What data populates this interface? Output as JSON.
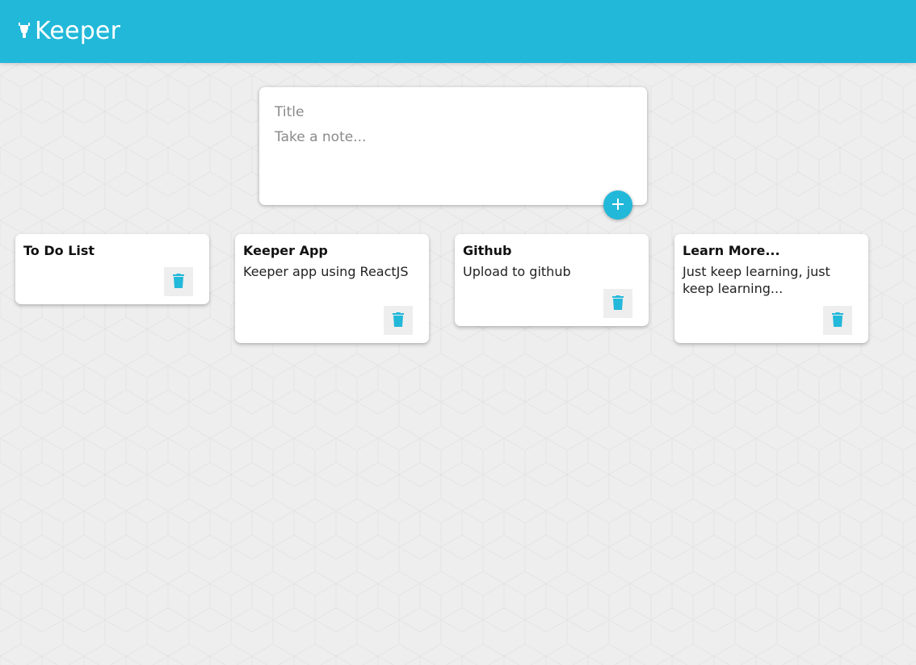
{
  "app": {
    "title": "Keeper",
    "accent_color": "#22b8d9",
    "logo_icon": "lightbulb-icon"
  },
  "create_note": {
    "title_placeholder": "Title",
    "content_placeholder": "Take a note...",
    "add_icon": "plus-icon"
  },
  "notes": [
    {
      "title": "To Do List",
      "content": "",
      "delete_icon": "trash-icon"
    },
    {
      "title": "Keeper App",
      "content": "Keeper app using ReactJS",
      "delete_icon": "trash-icon"
    },
    {
      "title": "Github",
      "content": "Upload to github",
      "delete_icon": "trash-icon"
    },
    {
      "title": "Learn More...",
      "content": "Just keep learning, just keep learning...",
      "delete_icon": "trash-icon"
    }
  ]
}
